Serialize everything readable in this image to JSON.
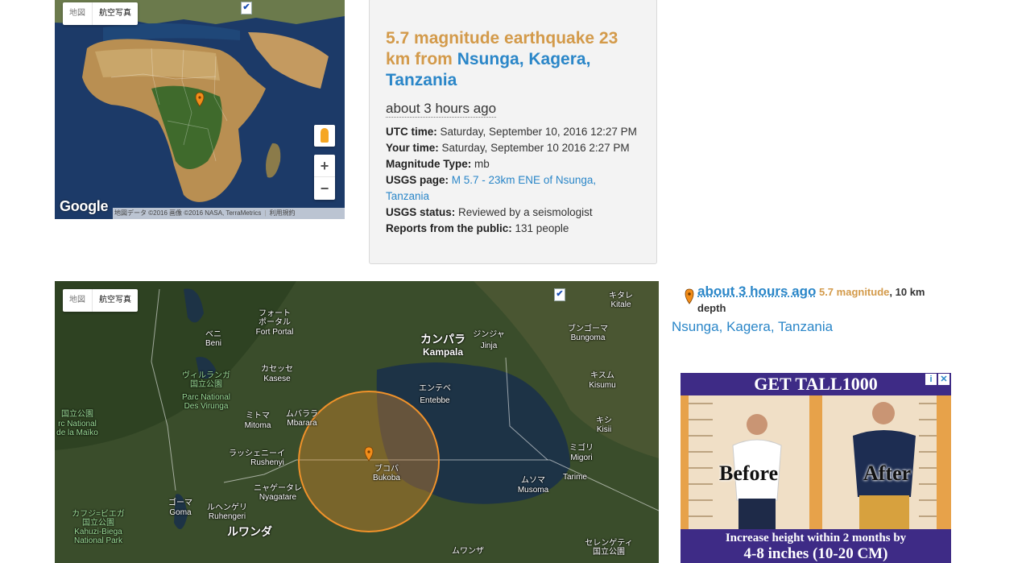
{
  "small_map": {
    "type_map": "地図",
    "type_satellite": "航空写真",
    "google": "Google",
    "attribution": "地図データ ©2016 画像 ©2016 NASA, TerraMetrics",
    "terms": "利用規約",
    "zoom_in": "+",
    "zoom_out": "−",
    "checkbox": "✔"
  },
  "quake": {
    "title_prefix": "5.7 magnitude earthquake 23 km from ",
    "place": "Nsunga, Kagera, Tanzania",
    "ago": "about 3 hours ago",
    "utc_label": "UTC time:",
    "utc_value": "Saturday, September 10, 2016 12:27 PM",
    "your_label": "Your time:",
    "your_value": "Saturday, September 10 2016 2:27 PM",
    "magtype_label": "Magnitude Type:",
    "magtype_value": "mb",
    "usgs_page_label": "USGS page:",
    "usgs_page_link": "M 5.7 - 23km ENE of Nsunga, Tanzania",
    "usgs_status_label": "USGS status:",
    "usgs_status_value": "Reviewed by a seismologist",
    "reports_label": "Reports from the public:",
    "reports_value": "131 people"
  },
  "big_map": {
    "type_map": "地図",
    "type_satellite": "航空写真",
    "checkbox": "✔",
    "places": {
      "fortportal_jp": "フォート\nポータル",
      "fortportal": "Fort Portal",
      "beni_jp": "ベニ",
      "beni": "Beni",
      "kampala_jp": "カンパラ",
      "kampala": "Kampala",
      "jinja_jp": "ジンジャ",
      "jinja": "Jinja",
      "bugoma_jp": "ブンゴーマ",
      "bugoma": "Bungoma",
      "kitale_jp": "キタレ",
      "kitale": "Kitale",
      "kasese_jp": "カセッセ",
      "kasese": "Kasese",
      "virunga_jp": "ヴィルランガ\n国立公園",
      "virunga": "Parc National\nDes Virunga",
      "entebbe_jp": "エンテベ",
      "entebbe": "Entebbe",
      "kisumu_jp": "キスム",
      "kisumu": "Kisumu",
      "kisii_jp": "キシ",
      "kisii": "Kisii",
      "mitoma_jp": "ミトマ",
      "mitoma": "Mitoma",
      "mbarara_jp": "ムバララ",
      "mbarara": "Mbarara",
      "maiko_jp": "国立公園",
      "maiko": "rc National\nde la Maïko",
      "rushenyi_jp": "ラッシェニーイ",
      "rushenyi": "Rushenyi",
      "nyagatare_jp": "ニャゲータレ",
      "nyagatare": "Nyagatare",
      "bukoba_jp": "ブコバ",
      "bukoba": "Bukoba",
      "migori_jp": "ミゴリ",
      "migori": "Migori",
      "tarime": "Tarime",
      "musoma_jp": "ムソマ",
      "musoma": "Musoma",
      "goma_jp": "ゴーマ",
      "goma": "Goma",
      "ruhengeri_jp": "ルヘンゲリ",
      "ruhengeri": "Ruhengeri",
      "kahuzi_jp": "カフジ=ビエガ\n国立公園",
      "kahuzi": "Kahuzi-Biega\nNational Park",
      "rwanda_jp": "ルワンダ",
      "mwanza_jp": "ムワンザ",
      "serengeti_jp": "セレンゲティ\n国立公園"
    }
  },
  "sidebar": {
    "ago": "about 3 hours ago",
    "magnitude": "5.7 magnitude",
    "depth": "10 km depth",
    "loc1": "Nsunga",
    "loc2": "Kagera",
    "loc3": "Tanzania"
  },
  "ad": {
    "headline": "GET TALL1000",
    "before": "Before",
    "after": "After",
    "line1": "Increase height within 2 months by",
    "line2": "4-8 inches (10-20 CM)",
    "info_icon": "i",
    "close_icon": "✕"
  },
  "colors": {
    "title_orange": "#d39a4a",
    "link_blue": "#2a86c8",
    "circle": "#f0922a"
  }
}
